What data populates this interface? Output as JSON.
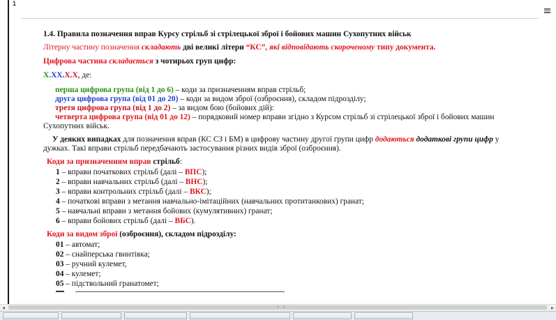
{
  "doc": {
    "top_mark": "1",
    "heading": "1.4. Правила позначення вправ Курсу стрільб зі стрілецької зброї і бойових машин Сухопутних військ",
    "p1": {
      "a": "Літерну частину позначення",
      "b": "складають",
      "c": "дві великі літери",
      "d": "“КС”,",
      "e": "які відповідають скороченому",
      "f": "типу документа."
    },
    "p2": {
      "a": "Цифрова частина",
      "b": "складається",
      "c": "з чотирьох груп цифр:"
    },
    "p3": {
      "x1": "Х.",
      "x2": "ХХ.",
      "x3": "Х.",
      "x4": "Х",
      "tail": ", де:"
    },
    "groups": [
      {
        "label": "перша цифрова група (від 1 до 6)",
        "text": " – коди за призначенням вправ стрільб;"
      },
      {
        "label": "друга цифрова група (від 01 до 20)",
        "text": " – коди за видом зброї (озброєння), складом підрозділу;"
      },
      {
        "label": "третя цифрова група (від 1 до 2)",
        "text": " – за видом бою (бойових дій):"
      },
      {
        "label": "четверта цифрова група (від 01 до 12)",
        "text": " – порядковий номер вправи згідно з Курсом стрільб зі стрілецької зброї і бойових машин"
      }
    ],
    "group4_cont": "Сухопутних військ.",
    "p4": {
      "a": "У деяких випадках",
      "b": " для позначення вправ (КС СЗ і БМ) в цифрову частину другої групи цифр ",
      "c": "додаються",
      "d": "додаткові групи цифр",
      "e": " у",
      "cont": "дужках. Такі вправи стрільб передбачають застосування різних видів зброї (озброєння)."
    },
    "codes_purpose": {
      "title_red": "Коди за призначенням вправ",
      "title_black": " стрільб",
      "colon": ":",
      "items": [
        {
          "n": "1",
          "pre": " – вправи початкових стрільб (далі – ",
          "abbr": "ВПС",
          "post": ");"
        },
        {
          "n": "2",
          "pre": " – вправи навчальних стрільб (далі – ",
          "abbr": "ВНС",
          "post": ");"
        },
        {
          "n": "3",
          "pre": " – вправи контрольних стрільб (далі – ",
          "abbr": "ВКС",
          "post": ");"
        },
        {
          "n": "4",
          "pre": " – початкові вправи з метання навчально-імітаційних (навчальних протитанкових) гранат;",
          "abbr": "",
          "post": ""
        },
        {
          "n": "5",
          "pre": " – навчальні вправи з метання бойових (кумулятивних) гранат;",
          "abbr": "",
          "post": ""
        },
        {
          "n": "6",
          "pre": " – вправи бойових стрільб (далі – ",
          "abbr": "ВБС",
          "post": ")."
        }
      ]
    },
    "codes_weapon": {
      "title_red": "Коди за видом зброї",
      "title_black": " (озброєння), складом підрозділу:",
      "items": [
        {
          "n": "01",
          "text": " – автомат;"
        },
        {
          "n": "02",
          "text": " – снайперська гвинтівка;"
        },
        {
          "n": "03",
          "text": " – ручний кулемет,"
        },
        {
          "n": "04",
          "text": " – кулемет;"
        },
        {
          "n": "05",
          "text": " – підствольний гранатомет;"
        }
      ]
    }
  },
  "colors": {
    "red": "#e0141e",
    "green": "#2e8b1a",
    "blue": "#1f3fd6"
  }
}
